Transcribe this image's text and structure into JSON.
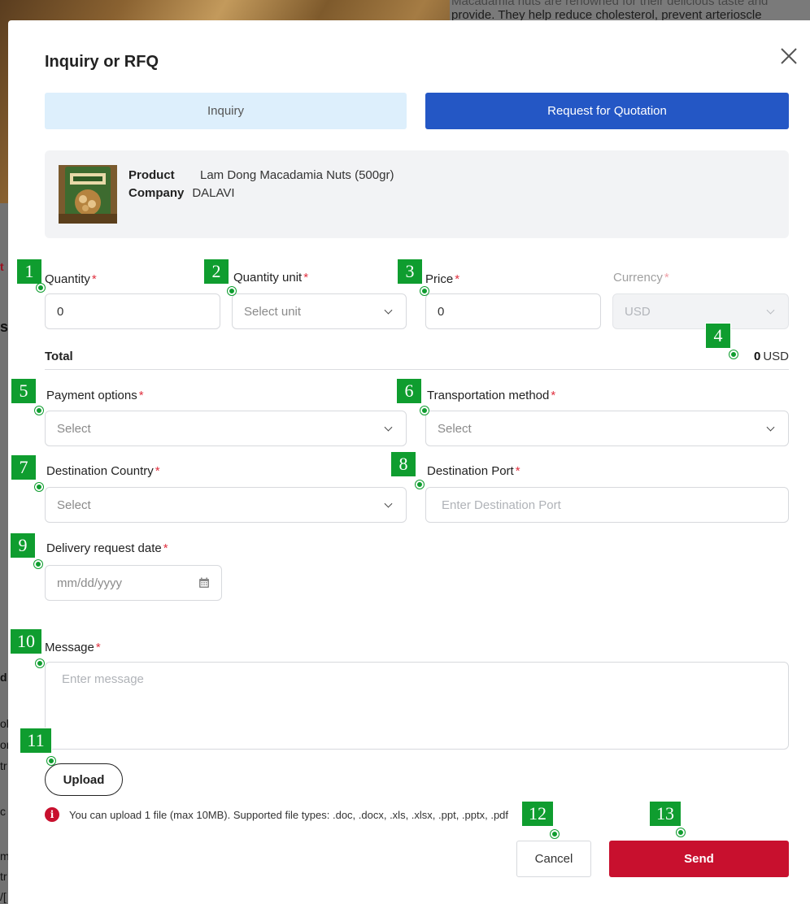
{
  "background": {
    "text_line1": "Macadamia nuts are renowned for their delicious taste and",
    "text_line2": "provide. They help reduce cholesterol, prevent arterioscle",
    "left_fragments": [
      "t",
      "s",
      "d",
      "ol",
      "on",
      "tr",
      "c",
      "m",
      "tr",
      "/["
    ]
  },
  "modal": {
    "title": "Inquiry or RFQ",
    "close_icon": "close-icon",
    "tabs": [
      {
        "label": "Inquiry",
        "active": false
      },
      {
        "label": "Request for Quotation",
        "active": true
      }
    ],
    "product": {
      "product_key": "Product",
      "product_value": "Lam Dong Macadamia Nuts (500gr)",
      "company_key": "Company",
      "company_value": "DALAVI"
    },
    "form": {
      "quantity": {
        "label": "Quantity",
        "value": "0"
      },
      "quantity_unit": {
        "label": "Quantity unit",
        "value": "Select unit"
      },
      "price": {
        "label": "Price",
        "value": "0"
      },
      "currency": {
        "label": "Currency",
        "value": "USD"
      },
      "total": {
        "label": "Total",
        "amount": "0",
        "currency": "USD"
      },
      "payment_options": {
        "label": "Payment options",
        "value": "Select"
      },
      "transportation_method": {
        "label": "Transportation method",
        "value": "Select"
      },
      "destination_country": {
        "label": "Destination Country",
        "value": "Select"
      },
      "destination_port": {
        "label": "Destination Port",
        "placeholder": "Enter Destination Port"
      },
      "delivery_date": {
        "label": "Delivery request date",
        "placeholder": "mm/dd/yyyy"
      },
      "message": {
        "label": "Message",
        "placeholder": "Enter message"
      },
      "required_mark": "*"
    },
    "upload": {
      "button": "Upload",
      "note": "You can upload 1 file (max 10MB). Supported file types: .doc, .docx, .xls, .xlsx, .ppt, .pptx, .pdf",
      "info_icon": "i"
    },
    "actions": {
      "cancel": "Cancel",
      "send": "Send"
    }
  },
  "markers": [
    "1",
    "2",
    "3",
    "4",
    "5",
    "6",
    "7",
    "8",
    "9",
    "10",
    "11",
    "12",
    "13"
  ],
  "colors": {
    "primary": "#2457c5",
    "tab_inactive": "#ddeffc",
    "send": "#c8102e",
    "marker": "#0f9d2f",
    "required": "#e0303f"
  }
}
